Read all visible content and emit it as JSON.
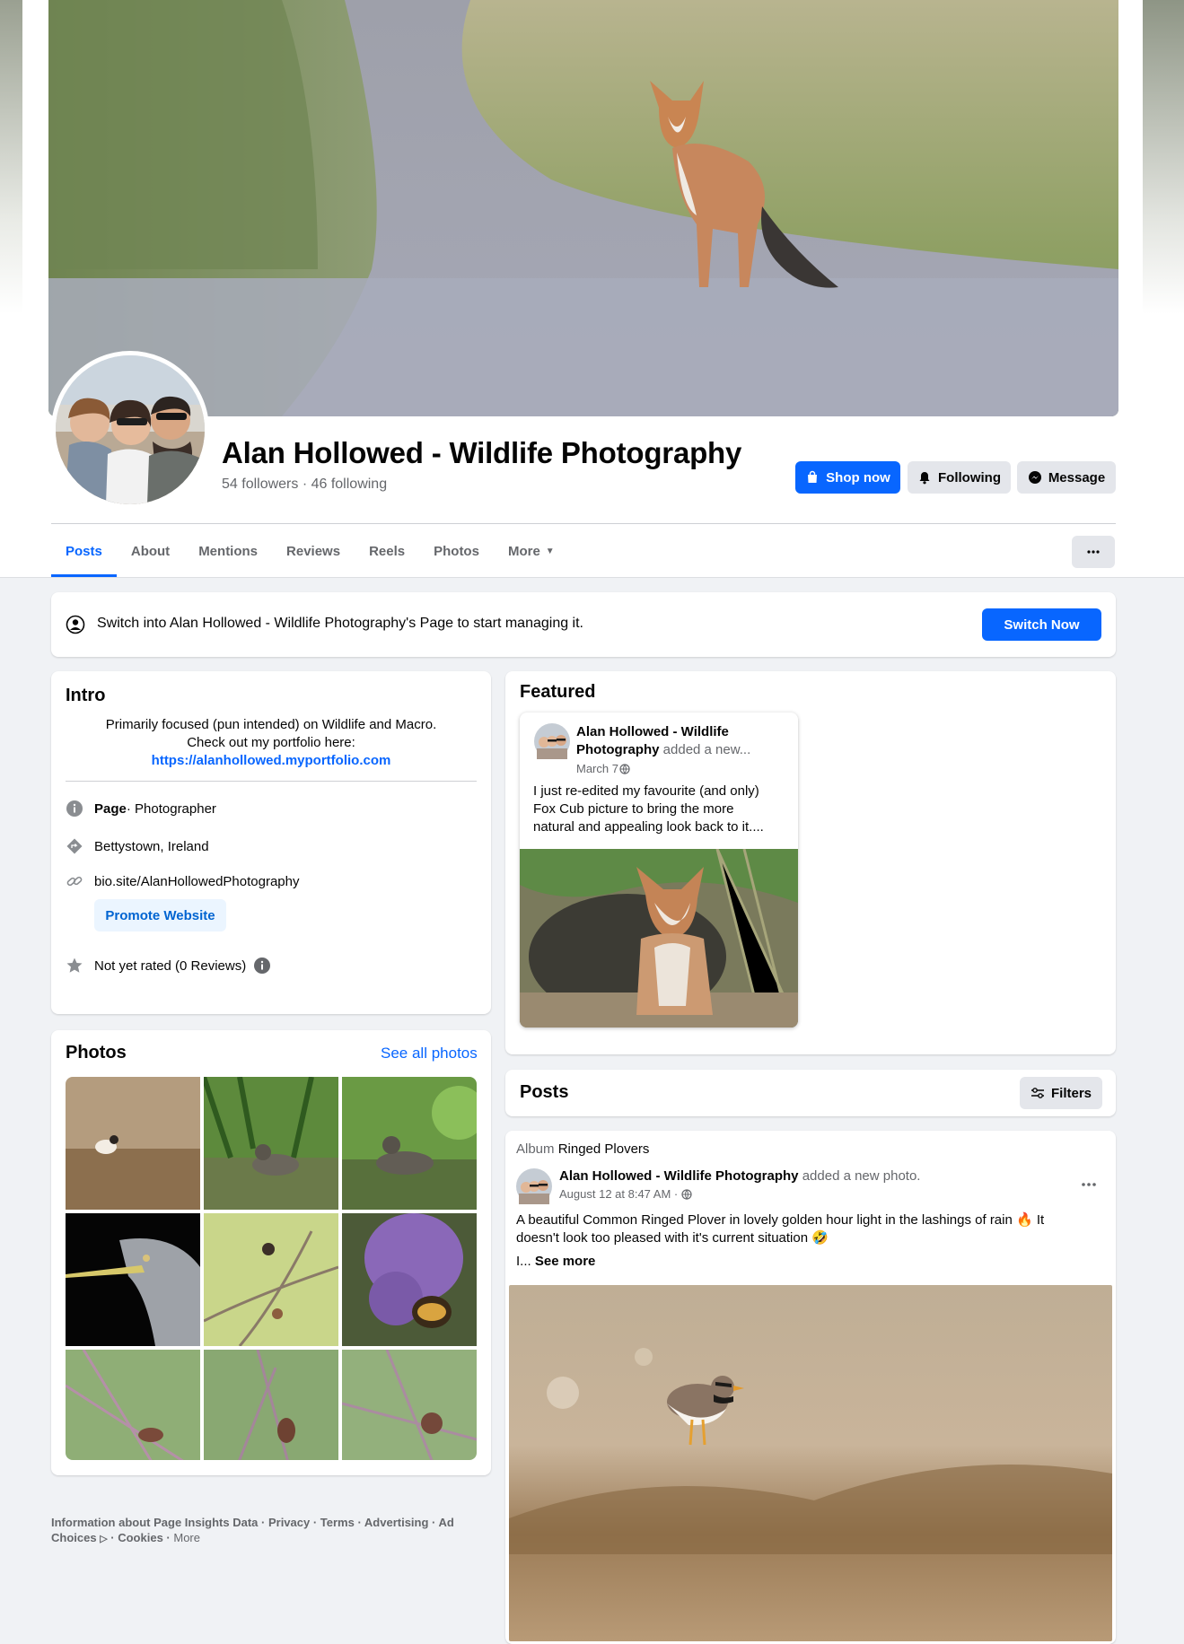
{
  "profile": {
    "name": "Alan Hollowed - Wildlife Photography",
    "stats": "54 followers · 46 following"
  },
  "actions": {
    "shop_now": "Shop now",
    "following": "Following",
    "message": "Message"
  },
  "tabs": [
    "Posts",
    "About",
    "Mentions",
    "Reviews",
    "Reels",
    "Photos",
    "More"
  ],
  "active_tab": "Posts",
  "switch_banner": {
    "text": "Switch into Alan Hollowed - Wildlife Photography's Page to start managing it.",
    "button": "Switch Now"
  },
  "intro": {
    "title": "Intro",
    "bio_line1": "Primarily focused (pun intended) on Wildlife and Macro.",
    "bio_line2": "Check out my portfolio here:",
    "bio_link": "https://alanhollowed.myportfolio.com",
    "page_label": "Page",
    "page_category": " · Photographer",
    "location": "Bettystown, Ireland",
    "website": "bio.site/AlanHollowedPhotography",
    "promote_button": "Promote Website",
    "rating": "Not yet rated (0 Reviews)"
  },
  "photos": {
    "title": "Photos",
    "see_all": "See all photos"
  },
  "footer": {
    "line1": "Information about Page Insights Data · Privacy · Terms · Advertising · Ad",
    "line2": "Choices",
    "line2_rest": " · Cookies · ",
    "more": "More"
  },
  "featured": {
    "title": "Featured",
    "author_line1": "Alan Hollowed - Wildlife",
    "author_line2": "Photography",
    "added": " added a new...",
    "date": "March 7",
    "text_line1": "I just re-edited my favourite (and only)",
    "text_line2": "Fox Cub picture to bring the more",
    "text_line3": "natural and appealing look back to it...."
  },
  "posts": {
    "title": "Posts",
    "filters": "Filters",
    "album_label": "Album",
    "album_name": "Ringed Plovers",
    "author": "Alan Hollowed - Wildlife Photography",
    "action": " added a new photo.",
    "timestamp": "August 12 at 8:47 AM ·",
    "text_line1": "A beautiful Common Ringed Plover in lovely golden hour light in the lashings of rain 🔥 It",
    "text_line2": "doesn't look too pleased with it's current situation 🤣",
    "ellipsis": "I... ",
    "see_more": "See more"
  },
  "colors": {
    "accent": "#0866ff",
    "secondary_text": "#65676b",
    "background": "#f0f2f5"
  }
}
